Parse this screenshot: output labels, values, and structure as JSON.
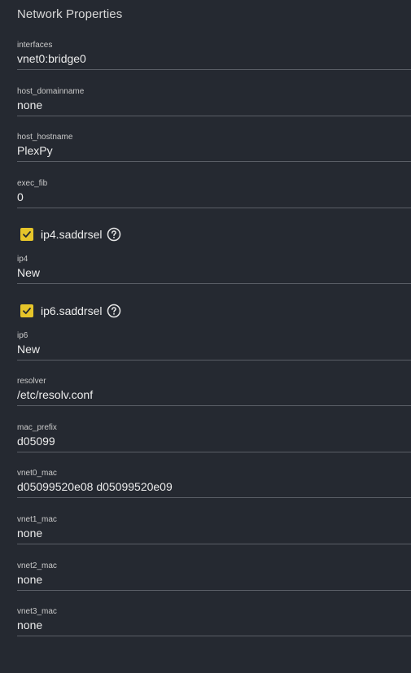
{
  "section": {
    "title": "Network Properties"
  },
  "fields": {
    "interfaces": {
      "label": "interfaces",
      "value": "vnet0:bridge0"
    },
    "host_domainname": {
      "label": "host_domainname",
      "value": "none"
    },
    "host_hostname": {
      "label": "host_hostname",
      "value": "PlexPy"
    },
    "exec_fib": {
      "label": "exec_fib",
      "value": "0"
    },
    "ip4": {
      "label": "ip4",
      "value": "New"
    },
    "ip6": {
      "label": "ip6",
      "value": "New"
    },
    "resolver": {
      "label": "resolver",
      "value": "/etc/resolv.conf"
    },
    "mac_prefix": {
      "label": "mac_prefix",
      "value": "d05099"
    },
    "vnet0_mac": {
      "label": "vnet0_mac",
      "value": "d05099520e08 d05099520e09"
    },
    "vnet1_mac": {
      "label": "vnet1_mac",
      "value": "none"
    },
    "vnet2_mac": {
      "label": "vnet2_mac",
      "value": "none"
    },
    "vnet3_mac": {
      "label": "vnet3_mac",
      "value": "none"
    }
  },
  "checkboxes": {
    "ip4_saddrsel": {
      "label": "ip4.saddrsel",
      "checked": true,
      "icon": "help-circle-icon"
    },
    "ip6_saddrsel": {
      "label": "ip6.saddrsel",
      "checked": true,
      "icon": "help-circle-icon"
    }
  },
  "colors": {
    "background": "#252931",
    "checkbox_fill": "#e6c52a",
    "underline": "#5a5e66"
  }
}
